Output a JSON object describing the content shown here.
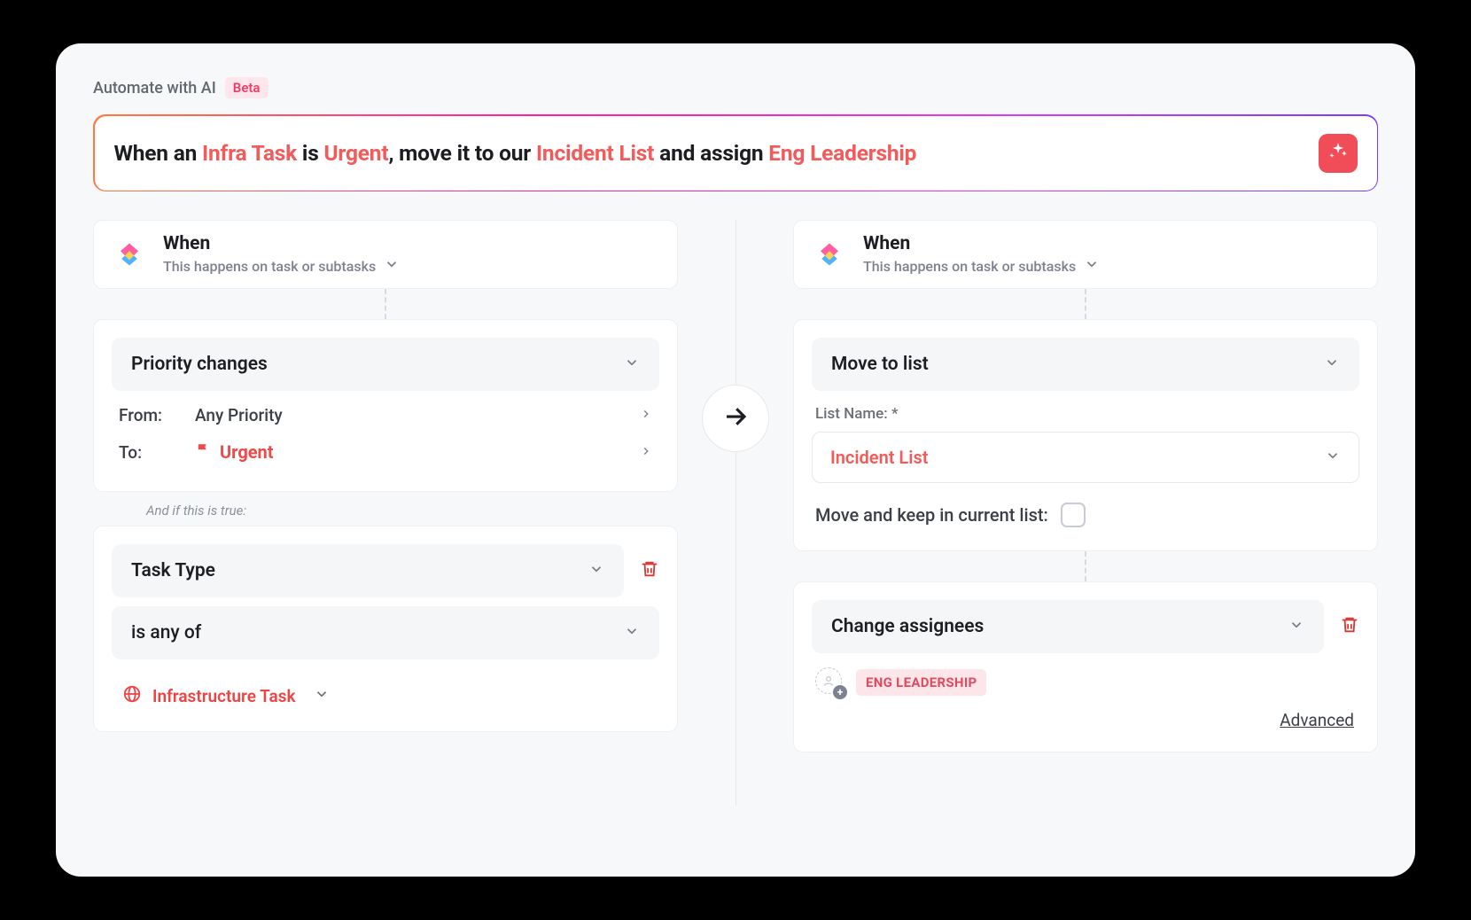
{
  "header": {
    "title": "Automate with AI",
    "badge": "Beta"
  },
  "prompt": {
    "p1": "When an ",
    "h1": "Infra Task",
    "p2": " is ",
    "h2": "Urgent",
    "p3": ", move it to our ",
    "h3": "Incident List",
    "p4": " and assign ",
    "h4": "Eng Leadership"
  },
  "left": {
    "when": {
      "title": "When",
      "subtitle": "This happens on task or subtasks"
    },
    "trigger": {
      "label": "Priority changes",
      "from_label": "From:",
      "from_value": "Any Priority",
      "to_label": "To:",
      "to_value": "Urgent"
    },
    "condition_header": "And if this is true:",
    "condition": {
      "field": "Task Type",
      "op": "is any of",
      "value": "Infrastructure Task"
    }
  },
  "right": {
    "when": {
      "title": "When",
      "subtitle": "This happens on task or subtasks"
    },
    "move": {
      "label": "Move to list",
      "list_field_label": "List Name: *",
      "list_value": "Incident List",
      "keep_label": "Move and keep in current list:"
    },
    "assign": {
      "label": "Change assignees",
      "chip": "ENG LEADERSHIP",
      "advanced": "Advanced"
    }
  }
}
